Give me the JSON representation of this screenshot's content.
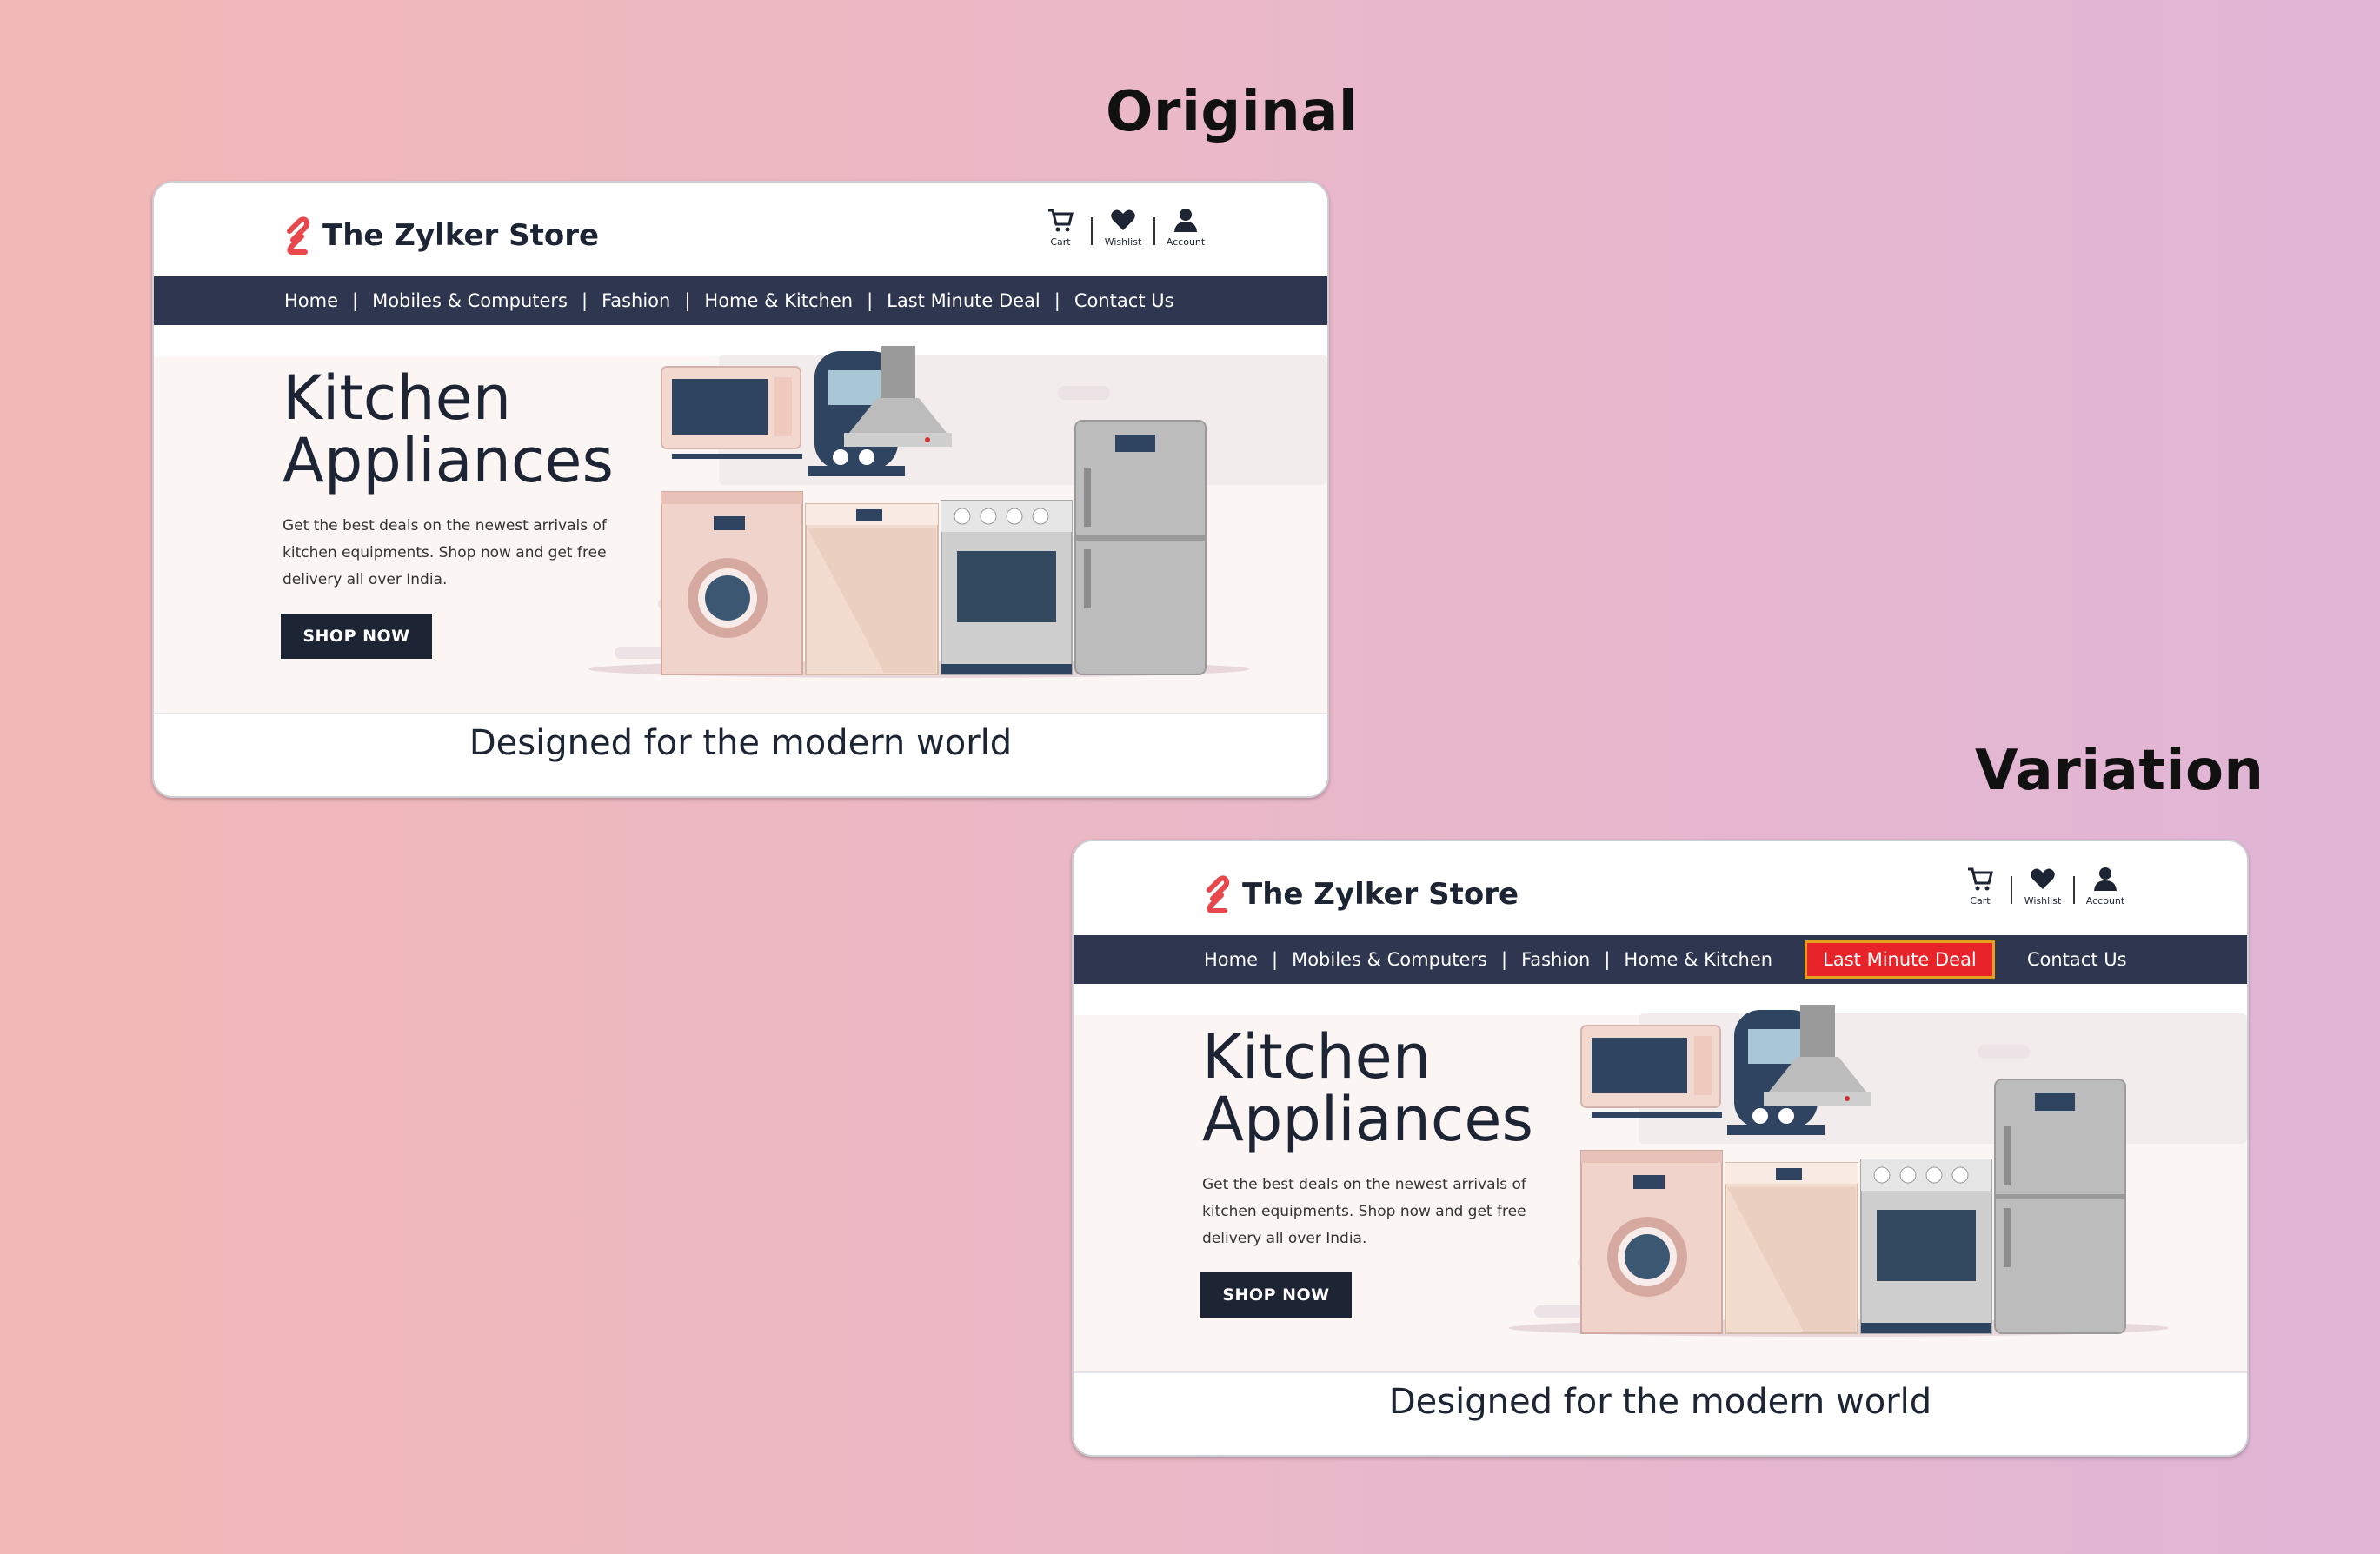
{
  "labels": {
    "original": "Original",
    "variation": "Variation"
  },
  "store": {
    "name": "The Zylker Store",
    "header_icons": {
      "cart": "Cart",
      "wishlist": "Wishlist",
      "account": "Account"
    },
    "nav": [
      "Home",
      "Mobiles & Computers",
      "Fashion",
      "Home & Kitchen",
      "Last Minute Deal",
      "Contact Us"
    ],
    "hero": {
      "title_line1": "Kitchen",
      "title_line2": "Appliances",
      "description": "Get the best deals on the newest arrivals of kitchen equipments. Shop now and get free delivery all over India.",
      "cta": "SHOP NOW"
    },
    "tagline": "Designed for the modern world"
  },
  "colors": {
    "nav_bg": "#2e3650",
    "accent_logo": "#e8474b",
    "highlight_bg": "#e8242a",
    "highlight_border": "#e6a020",
    "text_dark": "#1d2433"
  },
  "variation": {
    "highlighted_nav_item": "Last Minute Deal"
  },
  "icons": [
    "logo-icon",
    "cart-icon",
    "heart-icon",
    "account-icon"
  ]
}
